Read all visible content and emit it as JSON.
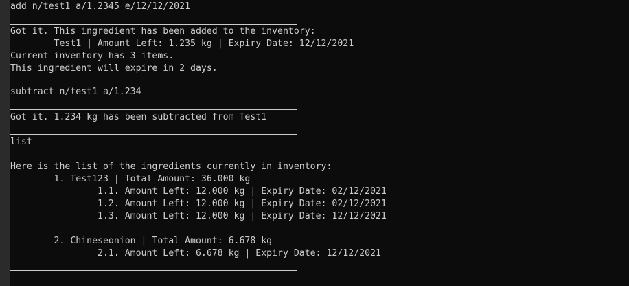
{
  "theme": {
    "background": "#0c0c0c",
    "foreground": "#cccccc",
    "gutter": "#2b2b2b"
  },
  "terminal": {
    "lines": [
      "add n/test1 a/1.2345 e/12/12/2021",
      "Got it. This ingredient has been added to the inventory:",
      "        Test1 | Amount Left: 1.235 kg | Expiry Date: 12/12/2021",
      "Current inventory has 3 items.",
      "This ingredient will expire in 2 days.",
      "subtract n/test1 a/1.234",
      "Got it. 1.234 kg has been subtracted from Test1",
      "list",
      "Here is the list of the ingredients currently in inventory:",
      "        1. Test123 | Total Amount: 36.000 kg",
      "                1.1. Amount Left: 12.000 kg | Expiry Date: 02/12/2021",
      "                1.2. Amount Left: 12.000 kg | Expiry Date: 02/12/2021",
      "                1.3. Amount Left: 12.000 kg | Expiry Date: 12/12/2021",
      "        2. Chineseonion | Total Amount: 6.678 kg",
      "                2.1. Amount Left: 6.678 kg | Expiry Date: 12/12/2021"
    ]
  }
}
